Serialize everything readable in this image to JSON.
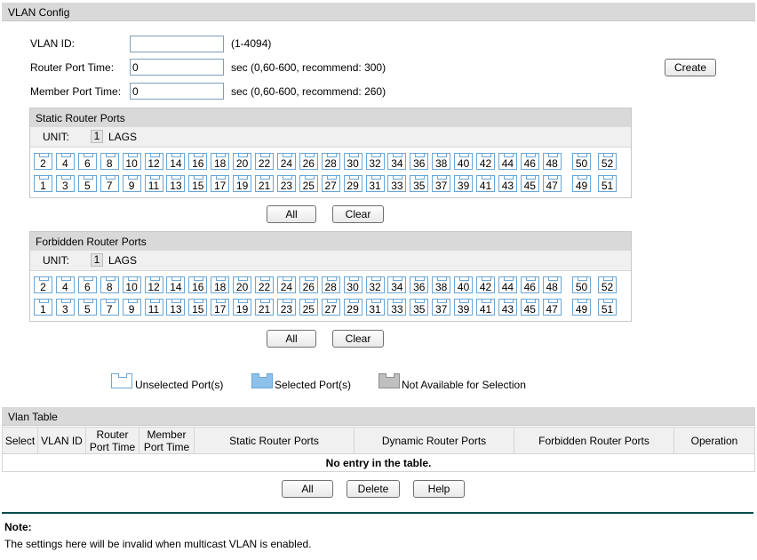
{
  "vlan_config": {
    "title": "VLAN Config",
    "vlan_id": {
      "label": "VLAN ID:",
      "value": "",
      "hint": "(1-4094)"
    },
    "router_port_time": {
      "label": "Router Port Time:",
      "value": "0",
      "hint": "sec (0,60-600, recommend: 300)"
    },
    "member_port_time": {
      "label": "Member Port Time:",
      "value": "0",
      "hint": "sec (0,60-600, recommend: 260)"
    },
    "create_label": "Create"
  },
  "static_router_ports": {
    "title": "Static Router Ports",
    "unit_label": "UNIT:",
    "unit_value": "1",
    "lags_label": "LAGS",
    "all_label": "All",
    "clear_label": "Clear"
  },
  "forbidden_router_ports": {
    "title": "Forbidden Router Ports",
    "unit_label": "UNIT:",
    "unit_value": "1",
    "lags_label": "LAGS",
    "all_label": "All",
    "clear_label": "Clear"
  },
  "ports": {
    "even": [
      "2",
      "4",
      "6",
      "8",
      "10",
      "12",
      "14",
      "16",
      "18",
      "20",
      "22",
      "24",
      "26",
      "28",
      "30",
      "32",
      "34",
      "36",
      "38",
      "40",
      "42",
      "44",
      "46",
      "48"
    ],
    "odd": [
      "1",
      "3",
      "5",
      "7",
      "9",
      "11",
      "13",
      "15",
      "17",
      "19",
      "21",
      "23",
      "25",
      "27",
      "29",
      "31",
      "33",
      "35",
      "37",
      "39",
      "41",
      "43",
      "45",
      "47"
    ],
    "extra_even": [
      "50",
      "52"
    ],
    "extra_odd": [
      "49",
      "51"
    ]
  },
  "legend": {
    "unselected": "Unselected Port(s)",
    "selected": "Selected Port(s)",
    "na": "Not Available for Selection",
    "colors": {
      "unselected": "#ffffff",
      "selected": "#8ec1ea",
      "na": "#bfbfbf"
    }
  },
  "vlan_table": {
    "title": "Vlan Table",
    "columns": {
      "select": "Select",
      "vlan_id": "VLAN ID",
      "router_port_time_1": "Router",
      "router_port_time_2": "Port Time",
      "member_port_time_1": "Member",
      "member_port_time_2": "Port Time",
      "static": "Static Router Ports",
      "dynamic": "Dynamic Router Ports",
      "forbidden": "Forbidden Router Ports",
      "operation": "Operation"
    },
    "empty_message": "No entry in the table.",
    "all_label": "All",
    "delete_label": "Delete",
    "help_label": "Help"
  },
  "note": {
    "title": "Note:",
    "text": "The settings here will be invalid when multicast VLAN is enabled."
  }
}
